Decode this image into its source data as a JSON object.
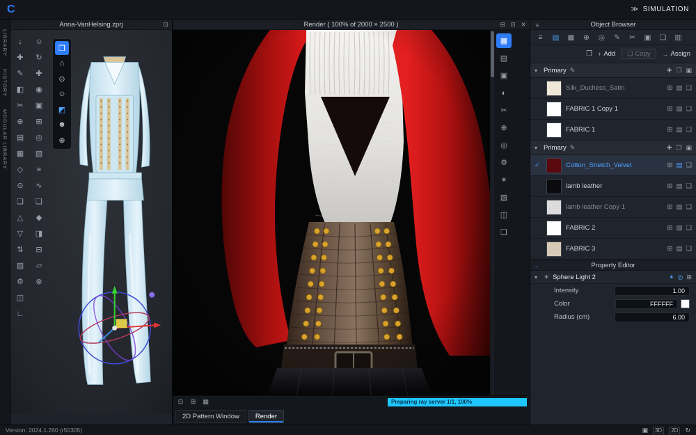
{
  "topbar": {
    "logo": "C",
    "simulation_chevrons": "≫",
    "simulation_label": "SIMULATION"
  },
  "left_rail": {
    "tabs": [
      {
        "name": "library",
        "label": "LIBRARY"
      },
      {
        "name": "history",
        "label": "HISTORY"
      },
      {
        "name": "modular-library",
        "label": "MODULAR LIBRARY"
      }
    ]
  },
  "ui_icons": {
    "caret_down": "▾",
    "check": "✓"
  },
  "viewport_panel": {
    "title": "Anna-VanHelsing.zprj",
    "pin_icon": "⊡",
    "tool_column_a": [
      {
        "name": "import-tool-icon",
        "glyph": "↓"
      },
      {
        "name": "move-tool-icon",
        "glyph": "✚"
      },
      {
        "name": "pen-tool-icon",
        "glyph": "✎"
      },
      {
        "name": "edit-texture-tool-icon",
        "glyph": "◧"
      },
      {
        "name": "scissors-tool-icon",
        "glyph": "✂"
      },
      {
        "name": "add-point-tool-icon",
        "glyph": "⊕"
      },
      {
        "name": "layers-tool-icon",
        "glyph": "▤"
      },
      {
        "name": "grid-tool-icon",
        "glyph": "▦"
      },
      {
        "name": "shape-tool-icon",
        "glyph": "◇"
      },
      {
        "name": "pin-tool-icon",
        "glyph": "⊙"
      },
      {
        "name": "copy-tool-icon",
        "glyph": "❏"
      },
      {
        "name": "sewing-tool-icon",
        "glyph": "△"
      },
      {
        "name": "flatten-tool-icon",
        "glyph": "▽"
      },
      {
        "name": "swap-tool-icon",
        "glyph": "⇅"
      },
      {
        "name": "mesh-tool-icon",
        "glyph": "▨"
      },
      {
        "name": "gear-tool-icon",
        "glyph": "⚙"
      },
      {
        "name": "layout-tool-icon",
        "glyph": "◫"
      },
      {
        "name": "measure-tool-icon",
        "glyph": "∟"
      }
    ],
    "tool_column_b": [
      {
        "name": "avatar-tool-icon",
        "glyph": "☺"
      },
      {
        "name": "rotate-tool-icon",
        "glyph": "↻"
      },
      {
        "name": "transform-tool-icon",
        "glyph": "✚"
      },
      {
        "name": "point-tool-icon",
        "glyph": "◉"
      },
      {
        "name": "box-tool-icon",
        "glyph": "▣"
      },
      {
        "name": "add-panel-tool-icon",
        "glyph": "⊞"
      },
      {
        "name": "circle-tool-icon",
        "glyph": "◎"
      },
      {
        "name": "hatch-tool-icon",
        "glyph": "▧"
      },
      {
        "name": "list-tool-icon",
        "glyph": "≡"
      },
      {
        "name": "curve-tool-icon",
        "glyph": "∿"
      },
      {
        "name": "duplicate-tool-icon",
        "glyph": "❏"
      },
      {
        "name": "gem-tool-icon",
        "glyph": "◆"
      },
      {
        "name": "half-tool-icon",
        "glyph": "◨"
      },
      {
        "name": "tape-tool-icon",
        "glyph": "⊟"
      },
      {
        "name": "steam-tool-icon",
        "glyph": "▱"
      },
      {
        "name": "target-tool-icon",
        "glyph": "⊗"
      }
    ],
    "floating_toolbar": [
      {
        "name": "gizmo-cube-icon",
        "glyph": "❒",
        "active": true
      },
      {
        "name": "home-view-icon",
        "glyph": "⌂"
      },
      {
        "name": "pin-view-icon",
        "glyph": "⊙"
      },
      {
        "name": "avatar-display-icon",
        "glyph": "☺"
      },
      {
        "name": "garment-display-icon",
        "glyph": "◩",
        "tint": true
      },
      {
        "name": "mannequin-display-icon",
        "glyph": "☻"
      },
      {
        "name": "environment-display-icon",
        "glyph": "⊕"
      }
    ]
  },
  "render_panel": {
    "title": "Render ( 100% of 2000 × 2500 )",
    "header_icons": [
      {
        "name": "dock-window-icon",
        "glyph": "⊟"
      },
      {
        "name": "float-window-icon",
        "glyph": "⊡"
      },
      {
        "name": "close-icon",
        "glyph": "✕"
      }
    ],
    "side_toolbar": [
      {
        "name": "render-grid-icon",
        "glyph": "▦",
        "active": true
      },
      {
        "name": "render-layers-icon",
        "glyph": "▤"
      },
      {
        "name": "render-frame-icon",
        "glyph": "▣"
      },
      {
        "name": "render-shading-icon",
        "glyph": "◐"
      },
      {
        "name": "render-crop-icon",
        "glyph": "✂"
      },
      {
        "name": "render-add-icon",
        "glyph": "⊕"
      },
      {
        "name": "render-focus-icon",
        "glyph": "◎"
      },
      {
        "name": "render-settings-icon",
        "glyph": "⚙"
      },
      {
        "name": "render-light-icon",
        "glyph": "✶"
      },
      {
        "name": "render-texture-icon",
        "glyph": "▧"
      },
      {
        "name": "render-split-icon",
        "glyph": "◫"
      },
      {
        "name": "render-copy-icon",
        "glyph": "❏"
      }
    ],
    "bottom_tools": [
      {
        "name": "zoom-actual-icon",
        "glyph": "⊡"
      },
      {
        "name": "fit-view-icon",
        "glyph": "⊞"
      },
      {
        "name": "grid-view-icon",
        "glyph": "▦"
      }
    ],
    "progress_text": "Preparing ray server 1/1, 100%",
    "progress_color": "#1ec8ff",
    "tabs": [
      {
        "label": "2D Pattern Window",
        "active": false
      },
      {
        "label": "Render",
        "active": true
      }
    ]
  },
  "object_browser": {
    "title": "Object Browser",
    "header_icon": "≡",
    "toolbar_icons": [
      {
        "name": "menu-icon",
        "glyph": "≡"
      },
      {
        "name": "fabric-list-icon",
        "glyph": "▤",
        "active": true
      },
      {
        "name": "texture-checker-icon",
        "glyph": "▦"
      },
      {
        "name": "add-object-icon",
        "glyph": "⊕"
      },
      {
        "name": "target-icon",
        "glyph": "◎"
      },
      {
        "name": "edit-icon",
        "glyph": "✎"
      },
      {
        "name": "cut-icon",
        "glyph": "✂"
      },
      {
        "name": "box-icon",
        "glyph": "▣"
      },
      {
        "name": "copy-object-icon",
        "glyph": "❏"
      },
      {
        "name": "grid-icon",
        "glyph": "▥"
      }
    ],
    "actions": {
      "folder_icon": "❒",
      "add_icon": "+",
      "add_label": "Add",
      "copy_icon": "❏",
      "copy_label": "Copy",
      "assign_icon": "→",
      "assign_label": "Assign"
    },
    "group_edit_icon": "✎",
    "group_icons": [
      {
        "name": "add-section-icon",
        "glyph": "✚"
      },
      {
        "name": "folder-icon",
        "glyph": "❒"
      },
      {
        "name": "box-icon",
        "glyph": "▣"
      }
    ],
    "row_icons": [
      {
        "name": "add-colorway-icon",
        "glyph": "⊞"
      },
      {
        "name": "properties-icon",
        "glyph": "▤"
      },
      {
        "name": "duplicate-icon",
        "glyph": "❏"
      }
    ],
    "rows": [
      {
        "type": "group",
        "label": "Primary"
      },
      {
        "type": "fabric",
        "name": "Silk_Duchess_Satin",
        "swatch": "#efe8d8",
        "muted": true
      },
      {
        "type": "fabric",
        "name": "FABRIC 1 Copy 1",
        "swatch": "#ffffff"
      },
      {
        "type": "fabric",
        "name": "FABRIC 1",
        "swatch": "#ffffff"
      },
      {
        "type": "group",
        "label": "Primary"
      },
      {
        "type": "fabric",
        "name": "Cotton_Stretch_Velvet",
        "swatch": "#5a090f",
        "selected": true
      },
      {
        "type": "fabric",
        "name": "lamb leather",
        "swatch": "#0b0b0d"
      },
      {
        "type": "fabric",
        "name": "lamb leather Copy 1",
        "swatch": "#dcdcdc",
        "muted": true
      },
      {
        "type": "fabric",
        "name": "FABRIC 2",
        "swatch": "#ffffff"
      },
      {
        "type": "fabric",
        "name": "FABRIC 3",
        "swatch": "#d6c9b6"
      }
    ]
  },
  "property_editor": {
    "title": "Property Editor",
    "collapse_icon": "→",
    "object_name": "Sphere Light 2",
    "object_icon": "☀",
    "object_icons": [
      {
        "name": "light-on-icon",
        "glyph": "✶",
        "accent": true
      },
      {
        "name": "render-visibility-icon",
        "glyph": "◎",
        "accent": true
      },
      {
        "name": "link-icon",
        "glyph": "⊞"
      }
    ],
    "properties": [
      {
        "label": "Intensity",
        "value": "1.00"
      },
      {
        "label": "Color",
        "value": "FFFFFF",
        "swatch": "#FFFFFF"
      },
      {
        "label": "Radius (cm)",
        "value": "6.00"
      }
    ]
  },
  "statusbar": {
    "version": "Version: 2024.1.260 (r50305)",
    "icons": [
      {
        "name": "panels-icon",
        "glyph": "▣"
      },
      {
        "name": "badge-3d",
        "label": "3D"
      },
      {
        "name": "badge-2d",
        "label": "2D"
      },
      {
        "name": "refresh-icon",
        "glyph": "↻"
      }
    ]
  },
  "colors": {
    "accent": "#2e7cf6",
    "selected_text": "#4da3ff",
    "progress": "#1ec8ff"
  }
}
